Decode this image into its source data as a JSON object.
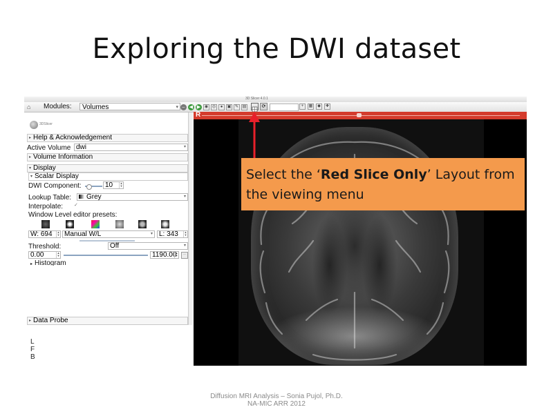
{
  "slide": {
    "title": "Exploring the DWI dataset",
    "footer_line1": "Diffusion MRI Analysis – Sonia Pujol, Ph.D.",
    "footer_line2": "NA-MIC ARR 2012"
  },
  "window": {
    "title": "3D Slicer 4.0.1"
  },
  "toolbar": {
    "modules_label": "Modules:",
    "module_selected": "Volumes"
  },
  "left_panel": {
    "logo_text": "3DSlicer",
    "help_section": "Help & Acknowledgement",
    "active_volume_label": "Active Volume",
    "active_volume_value": "dwi",
    "volume_info_section": "Volume Information",
    "display_section": "Display",
    "scalar_display_section": "Scalar Display",
    "dwi_component_label": "DWI Component:",
    "dwi_component_value": "10",
    "lookup_table_label": "Lookup Table:",
    "lookup_table_value": "Grey",
    "interpolate_label": "Interpolate:",
    "wl_presets_label": "Window Level editor presets:",
    "window_label": "W: 694",
    "window_mode": "Manual W/L",
    "level_label": "L: 343",
    "threshold_label": "Threshold:",
    "threshold_mode": "Off",
    "threshold_min": "0.00",
    "threshold_max": "1190.00",
    "histogram_section": "Histogram",
    "data_probe_section": "Data Probe"
  },
  "viewer": {
    "slice_label": "R",
    "callout_prefix": "Select the ‘",
    "callout_bold": "Red Slice Only",
    "callout_suffix": "’ Layout from the viewing menu"
  },
  "probe_labels": [
    "L",
    "F",
    "B"
  ],
  "colors": {
    "red_slice_bar": "#d43b2c",
    "callout_fill": "#f49a4c",
    "arrow": "#e8202a"
  },
  "icons": {
    "home": "house-icon",
    "layout": "layout-icon",
    "arrow": "red-arrow"
  }
}
